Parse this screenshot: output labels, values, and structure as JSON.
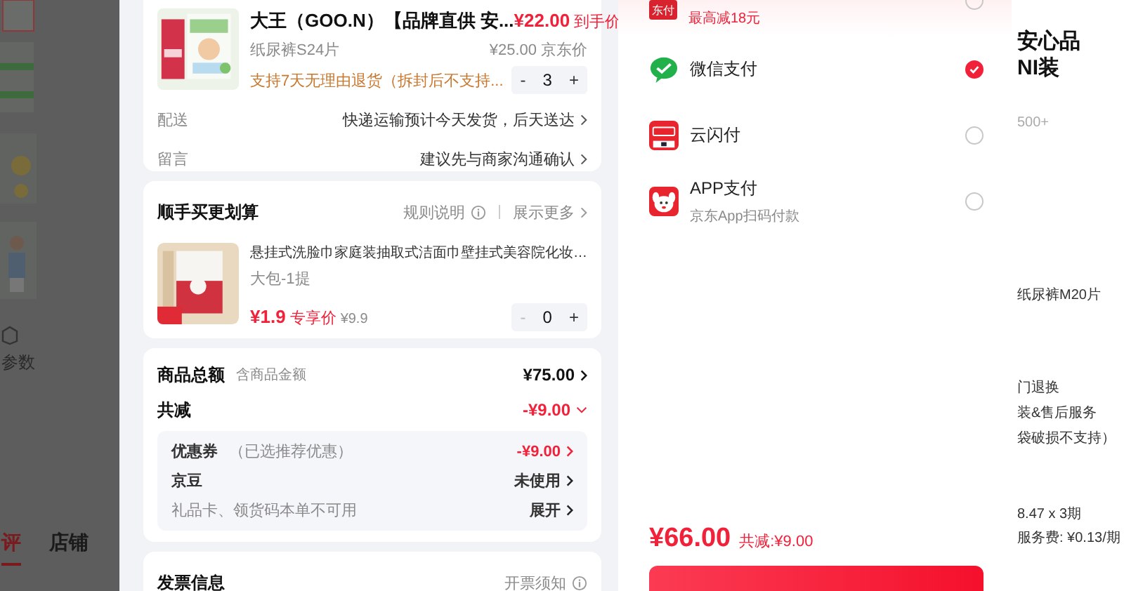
{
  "background_page": {
    "side_label": "参数",
    "tabs": [
      {
        "label": "评",
        "selected": true
      },
      {
        "label": "店铺",
        "selected": false
      }
    ],
    "right_texts": [
      {
        "text": "安心品",
        "kind": "title"
      },
      {
        "text": "NI装",
        "kind": "title"
      },
      {
        "text": "500+",
        "kind": "muted"
      },
      {
        "text": "纸尿裤M20片",
        "kind": "normal"
      },
      {
        "text": "门退换",
        "kind": "normal"
      },
      {
        "text": "装&售后服务",
        "kind": "normal"
      },
      {
        "text": "袋破损不支持）",
        "kind": "normal"
      },
      {
        "text": "8.47 x 3期",
        "kind": "normal"
      },
      {
        "text": "服务费: ¥0.13/期",
        "kind": "normal"
      }
    ]
  },
  "order": {
    "product": {
      "title": "大王（GOO.N）【品牌直供 安...",
      "price": "¥22.00",
      "price_tag": "到手价",
      "spec": "纸尿裤S24片",
      "orig_price": "¥25.00",
      "orig_tag": "京东价",
      "return_note": "支持7天无理由退货（拆封后不支持...",
      "minus": "-",
      "quantity": "3",
      "plus": "+"
    },
    "info_rows": [
      {
        "label": "配送",
        "value": "快递运输预计今天发货，后天送达"
      },
      {
        "label": "留言",
        "value": "建议先与商家沟通确认"
      }
    ],
    "addon": {
      "title": "顺手买更划算",
      "rules": "规则说明",
      "more": "展示更多",
      "item": {
        "title": "悬挂式洗脸巾家庭装抽取式洁面巾壁挂式美容院化妆…",
        "spec": "大包-1提",
        "price": "¥1.9",
        "price_tag": "专享价",
        "orig_price": "¥9.9",
        "minus": "-",
        "quantity": "0",
        "plus": "+"
      }
    },
    "summary": {
      "total_label": "商品总额",
      "total_note": "含商品金额",
      "total": "¥75.00",
      "discount_label": "共减",
      "discount": "-¥9.00",
      "expanded": true,
      "details": [
        {
          "label": "优惠券",
          "note": "（已选推荐优惠）",
          "value": "-¥9.00",
          "kind": "discount"
        },
        {
          "label": "京豆",
          "value": "未使用",
          "kind": "normal"
        },
        {
          "label": "礼品卡、领货码本单不可用",
          "value": "展开",
          "kind": "muted"
        }
      ]
    },
    "invoice": {
      "title": "发票信息",
      "link": "开票须知"
    }
  },
  "payment": {
    "methods": [
      {
        "kind": "jdpay",
        "icon_text": "东付",
        "note": "最高减18元",
        "selected": false
      },
      {
        "kind": "wechat",
        "name": "微信支付",
        "selected": true
      },
      {
        "kind": "unionpay",
        "name": "云闪付",
        "selected": false
      },
      {
        "kind": "app",
        "name": "APP支付",
        "note": "京东App扫码付款",
        "selected": false
      }
    ],
    "total": "¥66.00",
    "saved": "共减:¥9.00"
  }
}
